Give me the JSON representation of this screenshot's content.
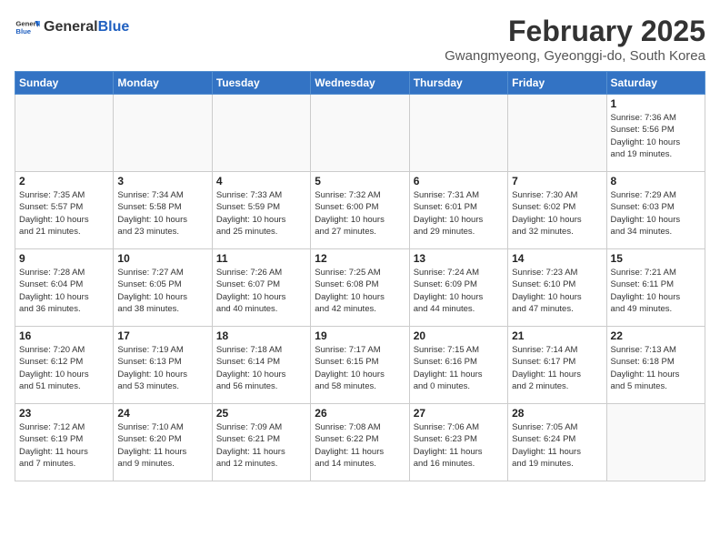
{
  "header": {
    "logo_general": "General",
    "logo_blue": "Blue",
    "month_year": "February 2025",
    "location": "Gwangmyeong, Gyeonggi-do, South Korea"
  },
  "weekdays": [
    "Sunday",
    "Monday",
    "Tuesday",
    "Wednesday",
    "Thursday",
    "Friday",
    "Saturday"
  ],
  "weeks": [
    [
      {
        "day": "",
        "info": ""
      },
      {
        "day": "",
        "info": ""
      },
      {
        "day": "",
        "info": ""
      },
      {
        "day": "",
        "info": ""
      },
      {
        "day": "",
        "info": ""
      },
      {
        "day": "",
        "info": ""
      },
      {
        "day": "1",
        "info": "Sunrise: 7:36 AM\nSunset: 5:56 PM\nDaylight: 10 hours\nand 19 minutes."
      }
    ],
    [
      {
        "day": "2",
        "info": "Sunrise: 7:35 AM\nSunset: 5:57 PM\nDaylight: 10 hours\nand 21 minutes."
      },
      {
        "day": "3",
        "info": "Sunrise: 7:34 AM\nSunset: 5:58 PM\nDaylight: 10 hours\nand 23 minutes."
      },
      {
        "day": "4",
        "info": "Sunrise: 7:33 AM\nSunset: 5:59 PM\nDaylight: 10 hours\nand 25 minutes."
      },
      {
        "day": "5",
        "info": "Sunrise: 7:32 AM\nSunset: 6:00 PM\nDaylight: 10 hours\nand 27 minutes."
      },
      {
        "day": "6",
        "info": "Sunrise: 7:31 AM\nSunset: 6:01 PM\nDaylight: 10 hours\nand 29 minutes."
      },
      {
        "day": "7",
        "info": "Sunrise: 7:30 AM\nSunset: 6:02 PM\nDaylight: 10 hours\nand 32 minutes."
      },
      {
        "day": "8",
        "info": "Sunrise: 7:29 AM\nSunset: 6:03 PM\nDaylight: 10 hours\nand 34 minutes."
      }
    ],
    [
      {
        "day": "9",
        "info": "Sunrise: 7:28 AM\nSunset: 6:04 PM\nDaylight: 10 hours\nand 36 minutes."
      },
      {
        "day": "10",
        "info": "Sunrise: 7:27 AM\nSunset: 6:05 PM\nDaylight: 10 hours\nand 38 minutes."
      },
      {
        "day": "11",
        "info": "Sunrise: 7:26 AM\nSunset: 6:07 PM\nDaylight: 10 hours\nand 40 minutes."
      },
      {
        "day": "12",
        "info": "Sunrise: 7:25 AM\nSunset: 6:08 PM\nDaylight: 10 hours\nand 42 minutes."
      },
      {
        "day": "13",
        "info": "Sunrise: 7:24 AM\nSunset: 6:09 PM\nDaylight: 10 hours\nand 44 minutes."
      },
      {
        "day": "14",
        "info": "Sunrise: 7:23 AM\nSunset: 6:10 PM\nDaylight: 10 hours\nand 47 minutes."
      },
      {
        "day": "15",
        "info": "Sunrise: 7:21 AM\nSunset: 6:11 PM\nDaylight: 10 hours\nand 49 minutes."
      }
    ],
    [
      {
        "day": "16",
        "info": "Sunrise: 7:20 AM\nSunset: 6:12 PM\nDaylight: 10 hours\nand 51 minutes."
      },
      {
        "day": "17",
        "info": "Sunrise: 7:19 AM\nSunset: 6:13 PM\nDaylight: 10 hours\nand 53 minutes."
      },
      {
        "day": "18",
        "info": "Sunrise: 7:18 AM\nSunset: 6:14 PM\nDaylight: 10 hours\nand 56 minutes."
      },
      {
        "day": "19",
        "info": "Sunrise: 7:17 AM\nSunset: 6:15 PM\nDaylight: 10 hours\nand 58 minutes."
      },
      {
        "day": "20",
        "info": "Sunrise: 7:15 AM\nSunset: 6:16 PM\nDaylight: 11 hours\nand 0 minutes."
      },
      {
        "day": "21",
        "info": "Sunrise: 7:14 AM\nSunset: 6:17 PM\nDaylight: 11 hours\nand 2 minutes."
      },
      {
        "day": "22",
        "info": "Sunrise: 7:13 AM\nSunset: 6:18 PM\nDaylight: 11 hours\nand 5 minutes."
      }
    ],
    [
      {
        "day": "23",
        "info": "Sunrise: 7:12 AM\nSunset: 6:19 PM\nDaylight: 11 hours\nand 7 minutes."
      },
      {
        "day": "24",
        "info": "Sunrise: 7:10 AM\nSunset: 6:20 PM\nDaylight: 11 hours\nand 9 minutes."
      },
      {
        "day": "25",
        "info": "Sunrise: 7:09 AM\nSunset: 6:21 PM\nDaylight: 11 hours\nand 12 minutes."
      },
      {
        "day": "26",
        "info": "Sunrise: 7:08 AM\nSunset: 6:22 PM\nDaylight: 11 hours\nand 14 minutes."
      },
      {
        "day": "27",
        "info": "Sunrise: 7:06 AM\nSunset: 6:23 PM\nDaylight: 11 hours\nand 16 minutes."
      },
      {
        "day": "28",
        "info": "Sunrise: 7:05 AM\nSunset: 6:24 PM\nDaylight: 11 hours\nand 19 minutes."
      },
      {
        "day": "",
        "info": ""
      }
    ]
  ]
}
